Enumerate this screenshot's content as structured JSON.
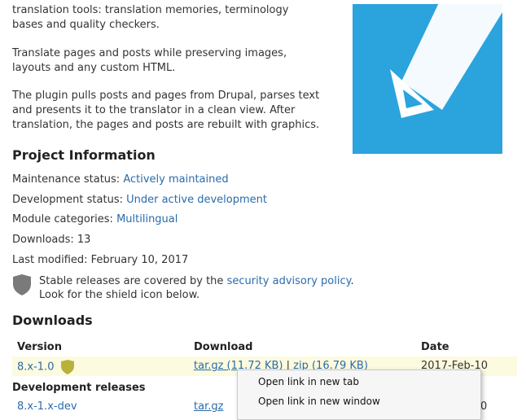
{
  "intro": {
    "partial_line1": "translation tools: translation memories, terminology",
    "partial_line2": "bases and quality checkers.",
    "para2_line1": "Translate pages and posts while preserving images,",
    "para2_line2": "layouts and any custom HTML.",
    "para3_line1": "The plugin pulls posts and pages from Drupal, parses text",
    "para3_line2": "and presents it to the translator in a clean view. After",
    "para3_line3": "translation, the pages and posts are rebuilt with graphics."
  },
  "logo": {
    "color": "#2ba3dc",
    "icon": "pencil-icon"
  },
  "project_info": {
    "heading": "Project Information",
    "maintenance_label": "Maintenance status: ",
    "maintenance_value": "Actively maintained",
    "development_label": "Development status: ",
    "development_value": "Under active development",
    "categories_label": "Module categories: ",
    "categories_value": "Multilingual",
    "downloads": "Downloads: 13",
    "last_modified": "Last modified: February 10, 2017",
    "security_text_pre": "Stable releases are covered by the ",
    "security_link": "security advisory policy",
    "security_text_post": ".",
    "security_line2": "Look for the shield icon below."
  },
  "downloads": {
    "heading": "Downloads",
    "columns": [
      "Version",
      "Download",
      "Date"
    ],
    "rows": [
      {
        "version": "8.x-1.0",
        "targz": "tar.gz (11.72 KB)",
        "sep": " | ",
        "zip": "zip (16.79 KB)",
        "date": "2017-Feb-10"
      }
    ],
    "dev_heading": "Development releases",
    "dev_rows": [
      {
        "version": "8.x-1.x-dev",
        "targz": "tar.gz",
        "date": "0"
      }
    ]
  },
  "context_menu": {
    "items": [
      "Open link in new tab",
      "Open link in new window"
    ]
  }
}
